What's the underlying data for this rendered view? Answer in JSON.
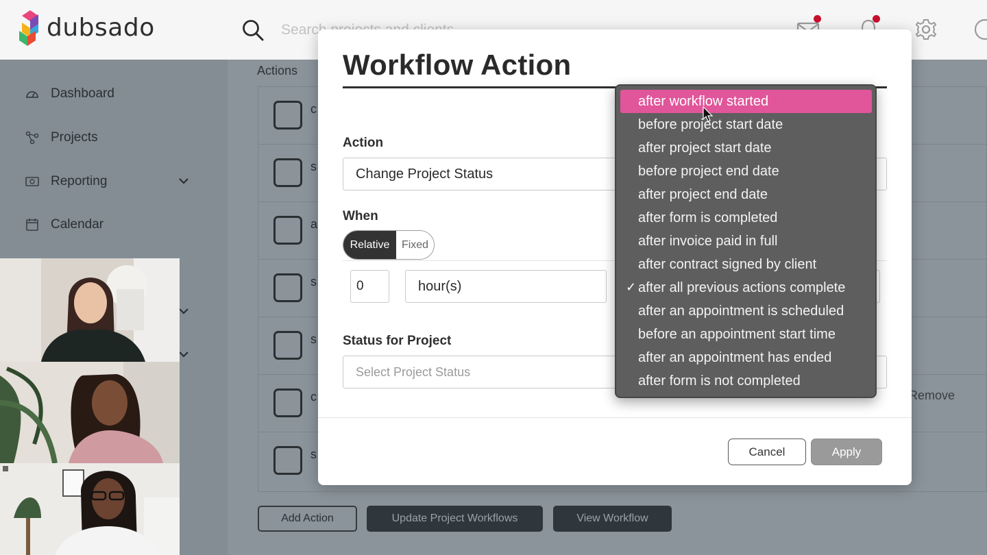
{
  "brand": {
    "name": "dubsado"
  },
  "search": {
    "placeholder": "Search projects and clients"
  },
  "sidebar": {
    "items": [
      {
        "label": "Dashboard",
        "icon": "dashboard-icon"
      },
      {
        "label": "Projects",
        "icon": "projects-icon"
      },
      {
        "label": "Reporting",
        "icon": "reporting-icon"
      },
      {
        "label": "Calendar",
        "icon": "calendar-icon"
      }
    ]
  },
  "main": {
    "actions_label": "Actions",
    "rows": [
      {
        "text": "c"
      },
      {
        "text": "s"
      },
      {
        "text": "a"
      },
      {
        "text": "s"
      },
      {
        "text": "s"
      },
      {
        "text": "c"
      },
      {
        "text": "s"
      }
    ],
    "remove_label": "Remove",
    "buttons": {
      "add_action": "Add Action",
      "update_workflows": "Update Project Workflows",
      "view_workflow": "View Workflow"
    }
  },
  "modal": {
    "title": "Workflow Action",
    "action_label": "Action",
    "action_value": "Change Project Status",
    "when_label": "When",
    "toggle": {
      "relative": "Relative",
      "fixed": "Fixed",
      "selected": "Relative"
    },
    "amount_value": "0",
    "unit_value": "hour(s)",
    "status_label": "Status for Project",
    "status_placeholder": "Select Project Status",
    "cancel_label": "Cancel",
    "apply_label": "Apply"
  },
  "dropdown": {
    "highlighted": "after workflow started",
    "checked": "after all previous actions complete",
    "check_mark": "✓",
    "options": [
      "after workflow started",
      "before project start date",
      "after project start date",
      "before project end date",
      "after project end date",
      "after form is completed",
      "after invoice paid in full",
      "after contract signed by client",
      "after all previous actions complete",
      "after an appointment is scheduled",
      "before an appointment start time",
      "after an appointment has ended",
      "after form is not completed"
    ]
  },
  "colors": {
    "highlight": "#e1559a",
    "notification_dot": "#c8102e",
    "overlay_dim": "#8b949b",
    "dropdown_bg": "#5e5e5e"
  }
}
